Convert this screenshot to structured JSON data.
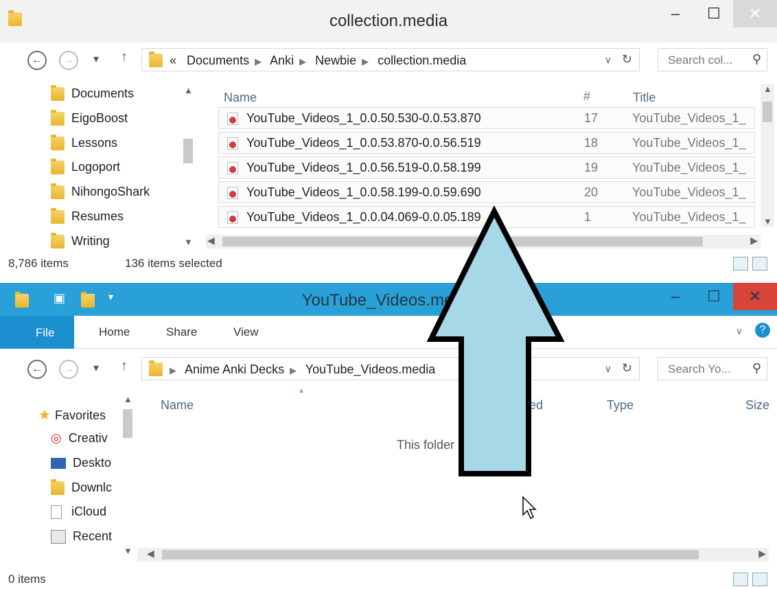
{
  "top_window": {
    "title": "collection.media",
    "breadcrumb": [
      "«",
      "Documents",
      "Anki",
      "Newbie",
      "collection.media"
    ],
    "search_placeholder": "Search col...",
    "nav_items": [
      "Documents",
      "EigoBoost",
      "Lessons",
      "Logoport",
      "NihongoShark",
      "Resumes",
      "Writing"
    ],
    "columns": {
      "name": "Name",
      "num": "#",
      "title": "Title"
    },
    "files": [
      {
        "name": "YouTube_Videos_1_0.0.50.530-0.0.53.870",
        "num": "17",
        "title": "YouTube_Videos_1_"
      },
      {
        "name": "YouTube_Videos_1_0.0.53.870-0.0.56.519",
        "num": "18",
        "title": "YouTube_Videos_1_"
      },
      {
        "name": "YouTube_Videos_1_0.0.56.519-0.0.58.199",
        "num": "19",
        "title": "YouTube_Videos_1_"
      },
      {
        "name": "YouTube_Videos_1_0.0.58.199-0.0.59.690",
        "num": "20",
        "title": "YouTube_Videos_1_"
      },
      {
        "name": "YouTube_Videos_1_0.0.04.069-0.0.05.189",
        "num": "1",
        "title": "YouTube_Videos_1_"
      }
    ],
    "status_count": "8,786 items",
    "status_selected": "136 items selected"
  },
  "bottom_window": {
    "title": "YouTube_Videos.media",
    "ribbon": {
      "file": "File",
      "home": "Home",
      "share": "Share",
      "view": "View"
    },
    "breadcrumb": [
      "Anime Anki Decks",
      "YouTube_Videos.media"
    ],
    "search_placeholder": "Search Yo...",
    "nav_items": [
      "Favorites",
      "Creativ",
      "Deskto",
      "Downlc",
      "iCloud",
      "Recent"
    ],
    "columns": {
      "name": "Name",
      "modified": "Date modified",
      "type": "Type",
      "size": "Size"
    },
    "empty_text": "This folder is empty.",
    "status_count": "0 items"
  },
  "colors": {
    "accent_blue": "#2aa0d8",
    "file_tab": "#1c8fd1",
    "arrow_fill": "#a6d8e8"
  }
}
